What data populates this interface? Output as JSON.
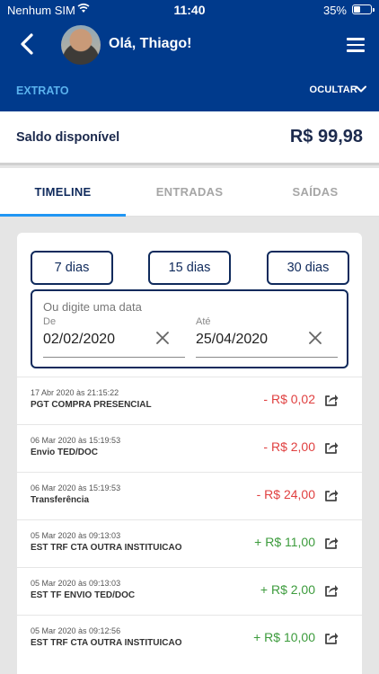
{
  "status_bar": {
    "carrier": "Nenhum SIM",
    "time": "11:40",
    "battery": "35%"
  },
  "header": {
    "greeting": "Olá, Thiago!"
  },
  "subheader": {
    "section": "EXTRATO",
    "toggle": "OCULTAR"
  },
  "balance": {
    "label": "Saldo disponível",
    "value": "R$ 99,98"
  },
  "tabs": [
    {
      "label": "TIMELINE"
    },
    {
      "label": "ENTRADAS"
    },
    {
      "label": "SAÍDAS"
    }
  ],
  "filters": {
    "quick": [
      {
        "label": "7 dias"
      },
      {
        "label": "15 dias"
      },
      {
        "label": "30 dias"
      }
    ],
    "custom_title": "Ou digite uma data",
    "from_label": "De",
    "from_value": "02/02/2020",
    "to_label": "Até",
    "to_value": "25/04/2020"
  },
  "transactions": [
    {
      "date": "17 Abr 2020 às 21:15:22",
      "description": "PGT COMPRA PRESENCIAL",
      "amount": "- R$ 0,02",
      "type": "debit"
    },
    {
      "date": "06 Mar 2020 às 15:19:53",
      "description": "Envio TED/DOC",
      "amount": "- R$ 2,00",
      "type": "debit"
    },
    {
      "date": "06 Mar 2020 às 15:19:53",
      "description": "Transferência",
      "amount": "- R$ 24,00",
      "type": "debit"
    },
    {
      "date": "05 Mar 2020 às 09:13:03",
      "description": "EST TRF CTA OUTRA INSTITUICAO",
      "amount": "+ R$ 11,00",
      "type": "credit"
    },
    {
      "date": "05 Mar 2020 às 09:13:03",
      "description": "EST TF ENVIO TED/DOC",
      "amount": "+ R$ 2,00",
      "type": "credit"
    },
    {
      "date": "05 Mar 2020 às 09:12:56",
      "description": "EST TRF CTA OUTRA INSTITUICAO",
      "amount": "+ R$ 10,00",
      "type": "credit"
    }
  ],
  "colors": {
    "header_bg": "#003a8c",
    "accent": "#2196f3",
    "debit": "#e04040",
    "credit": "#3c9b3c"
  },
  "icons": {
    "back": "back-arrow-icon",
    "menu": "hamburger-menu-icon",
    "toggle": "chevron-down-icon",
    "clear": "close-icon",
    "share": "share-icon"
  }
}
